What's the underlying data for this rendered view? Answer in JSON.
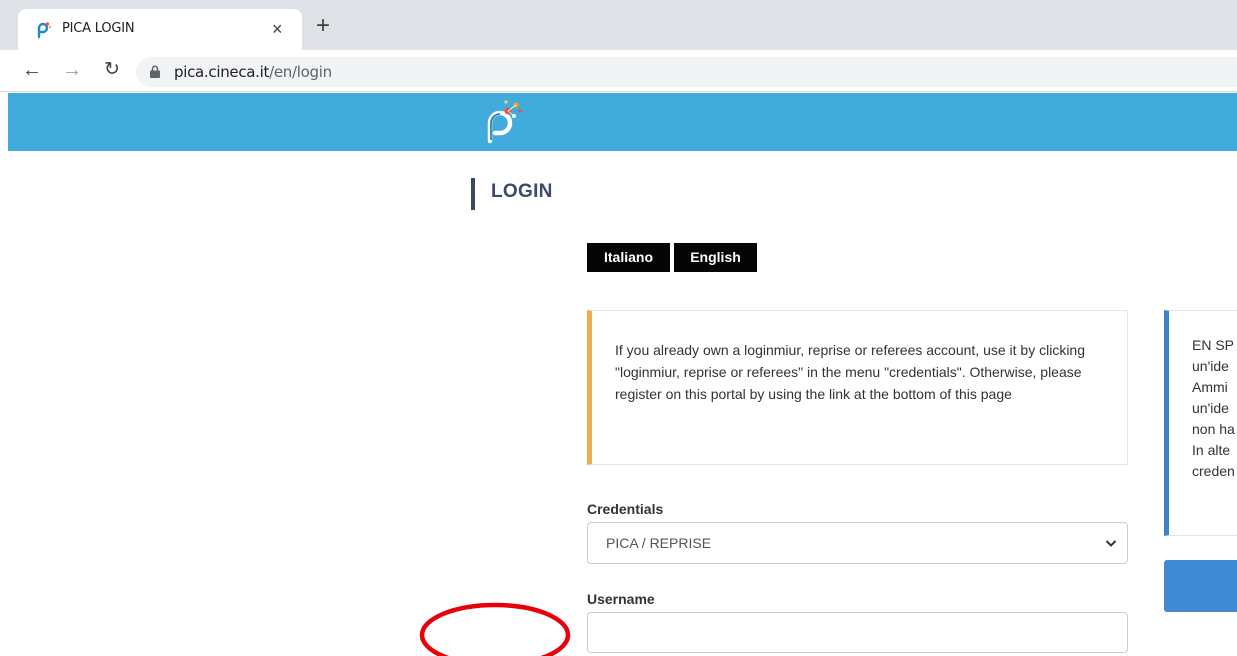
{
  "browser": {
    "tab_title": "PICA LOGIN",
    "tab_close_glyph": "×",
    "new_tab_glyph": "+",
    "url_host": "pica.cineca.it",
    "url_path": "/en/login",
    "icons": [
      "back-arrow-icon",
      "forward-arrow-icon",
      "reload-icon",
      "lock-icon",
      "pica-favicon-icon"
    ]
  },
  "header": {
    "logo": "pica-logo",
    "color": "#41abdc"
  },
  "page": {
    "title": "LOGIN",
    "languages": [
      "Italiano",
      "English"
    ],
    "info_message": "If you already own a loginmiur, reprise or referees account, use it by clicking \"loginmiur, reprise or referees\" in the menu \"credentials\". Otherwise, please register on this portal by using the link at the bottom of this page",
    "info_accent": "#f0ad4e",
    "side_panel": {
      "accent": "#3a84c8",
      "lines": [
        "EN SP",
        "un'ide",
        "Ammi",
        "un'ide",
        "non ha",
        "In alte",
        "creden"
      ]
    },
    "form": {
      "credentials_label": "Credentials",
      "credentials_value": "PICA / REPRISE",
      "username_label": "Username",
      "username_value": ""
    }
  },
  "annotation": {
    "color": "#e8000b"
  }
}
